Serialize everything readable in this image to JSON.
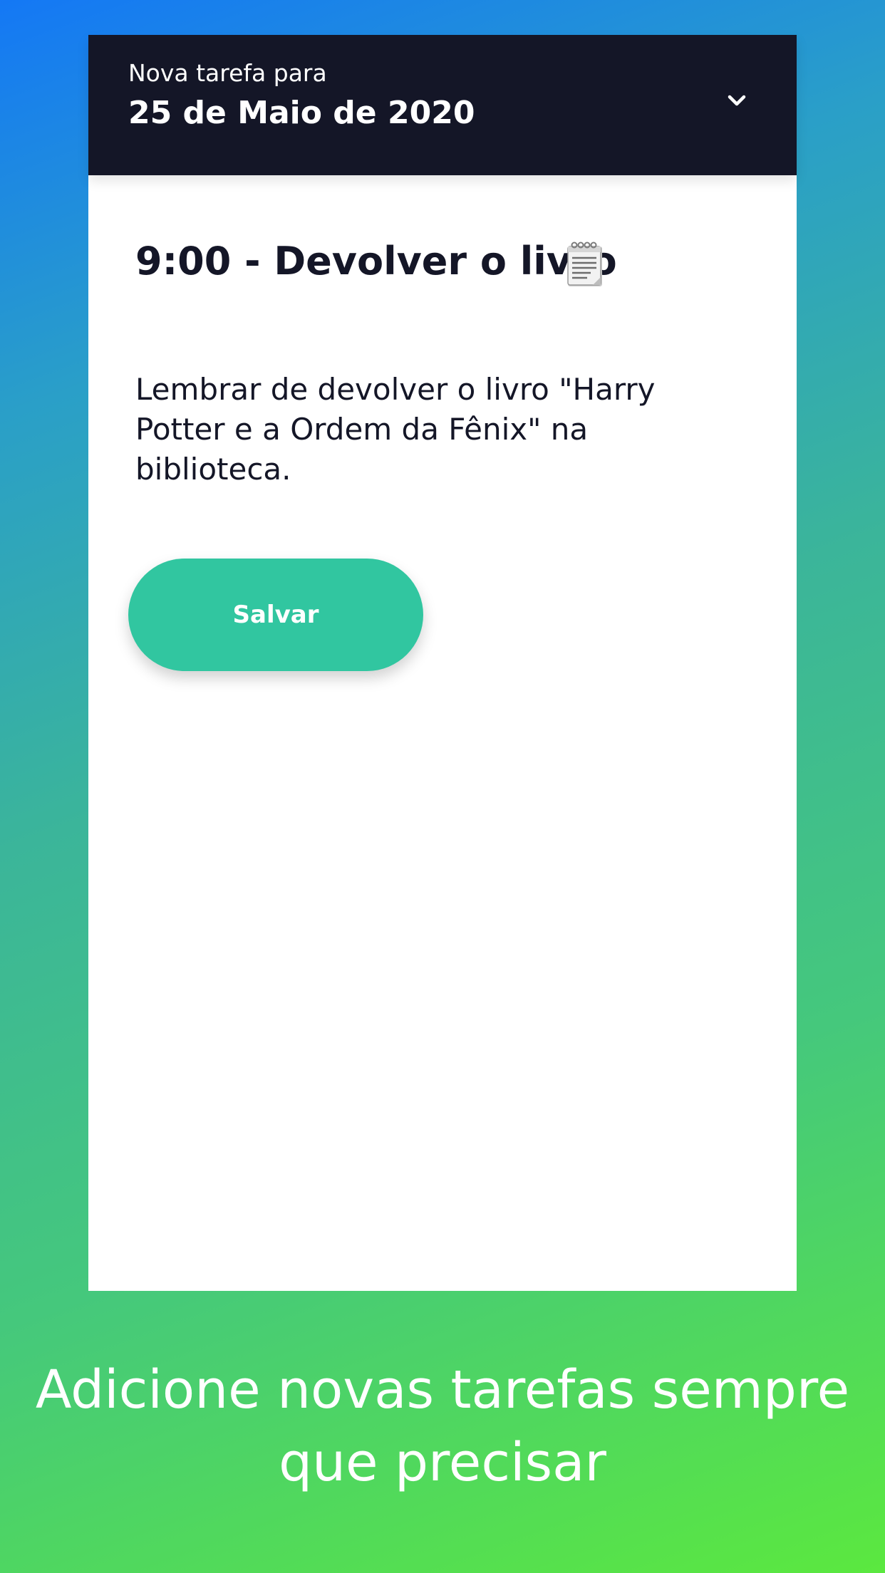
{
  "header": {
    "subtitle": "Nova tarefa para",
    "date": "25 de Maio de 2020",
    "dropdown_icon": "chevron-down-icon"
  },
  "task": {
    "title": "9:00 - Devolver o livro",
    "title_icon": "notepad-icon",
    "description": "Lembrar de devolver o livro \"Harry Potter e a Ordem da Fênix\" na biblioteca."
  },
  "actions": {
    "save_label": "Salvar"
  },
  "caption": {
    "text": "Adicione novas tarefas sempre que precisar"
  },
  "colors": {
    "header_bg": "#141627",
    "accent": "#31c6a0",
    "text_dark": "#141627",
    "gradient_start": "#1478f5",
    "gradient_end": "#5be83f"
  }
}
